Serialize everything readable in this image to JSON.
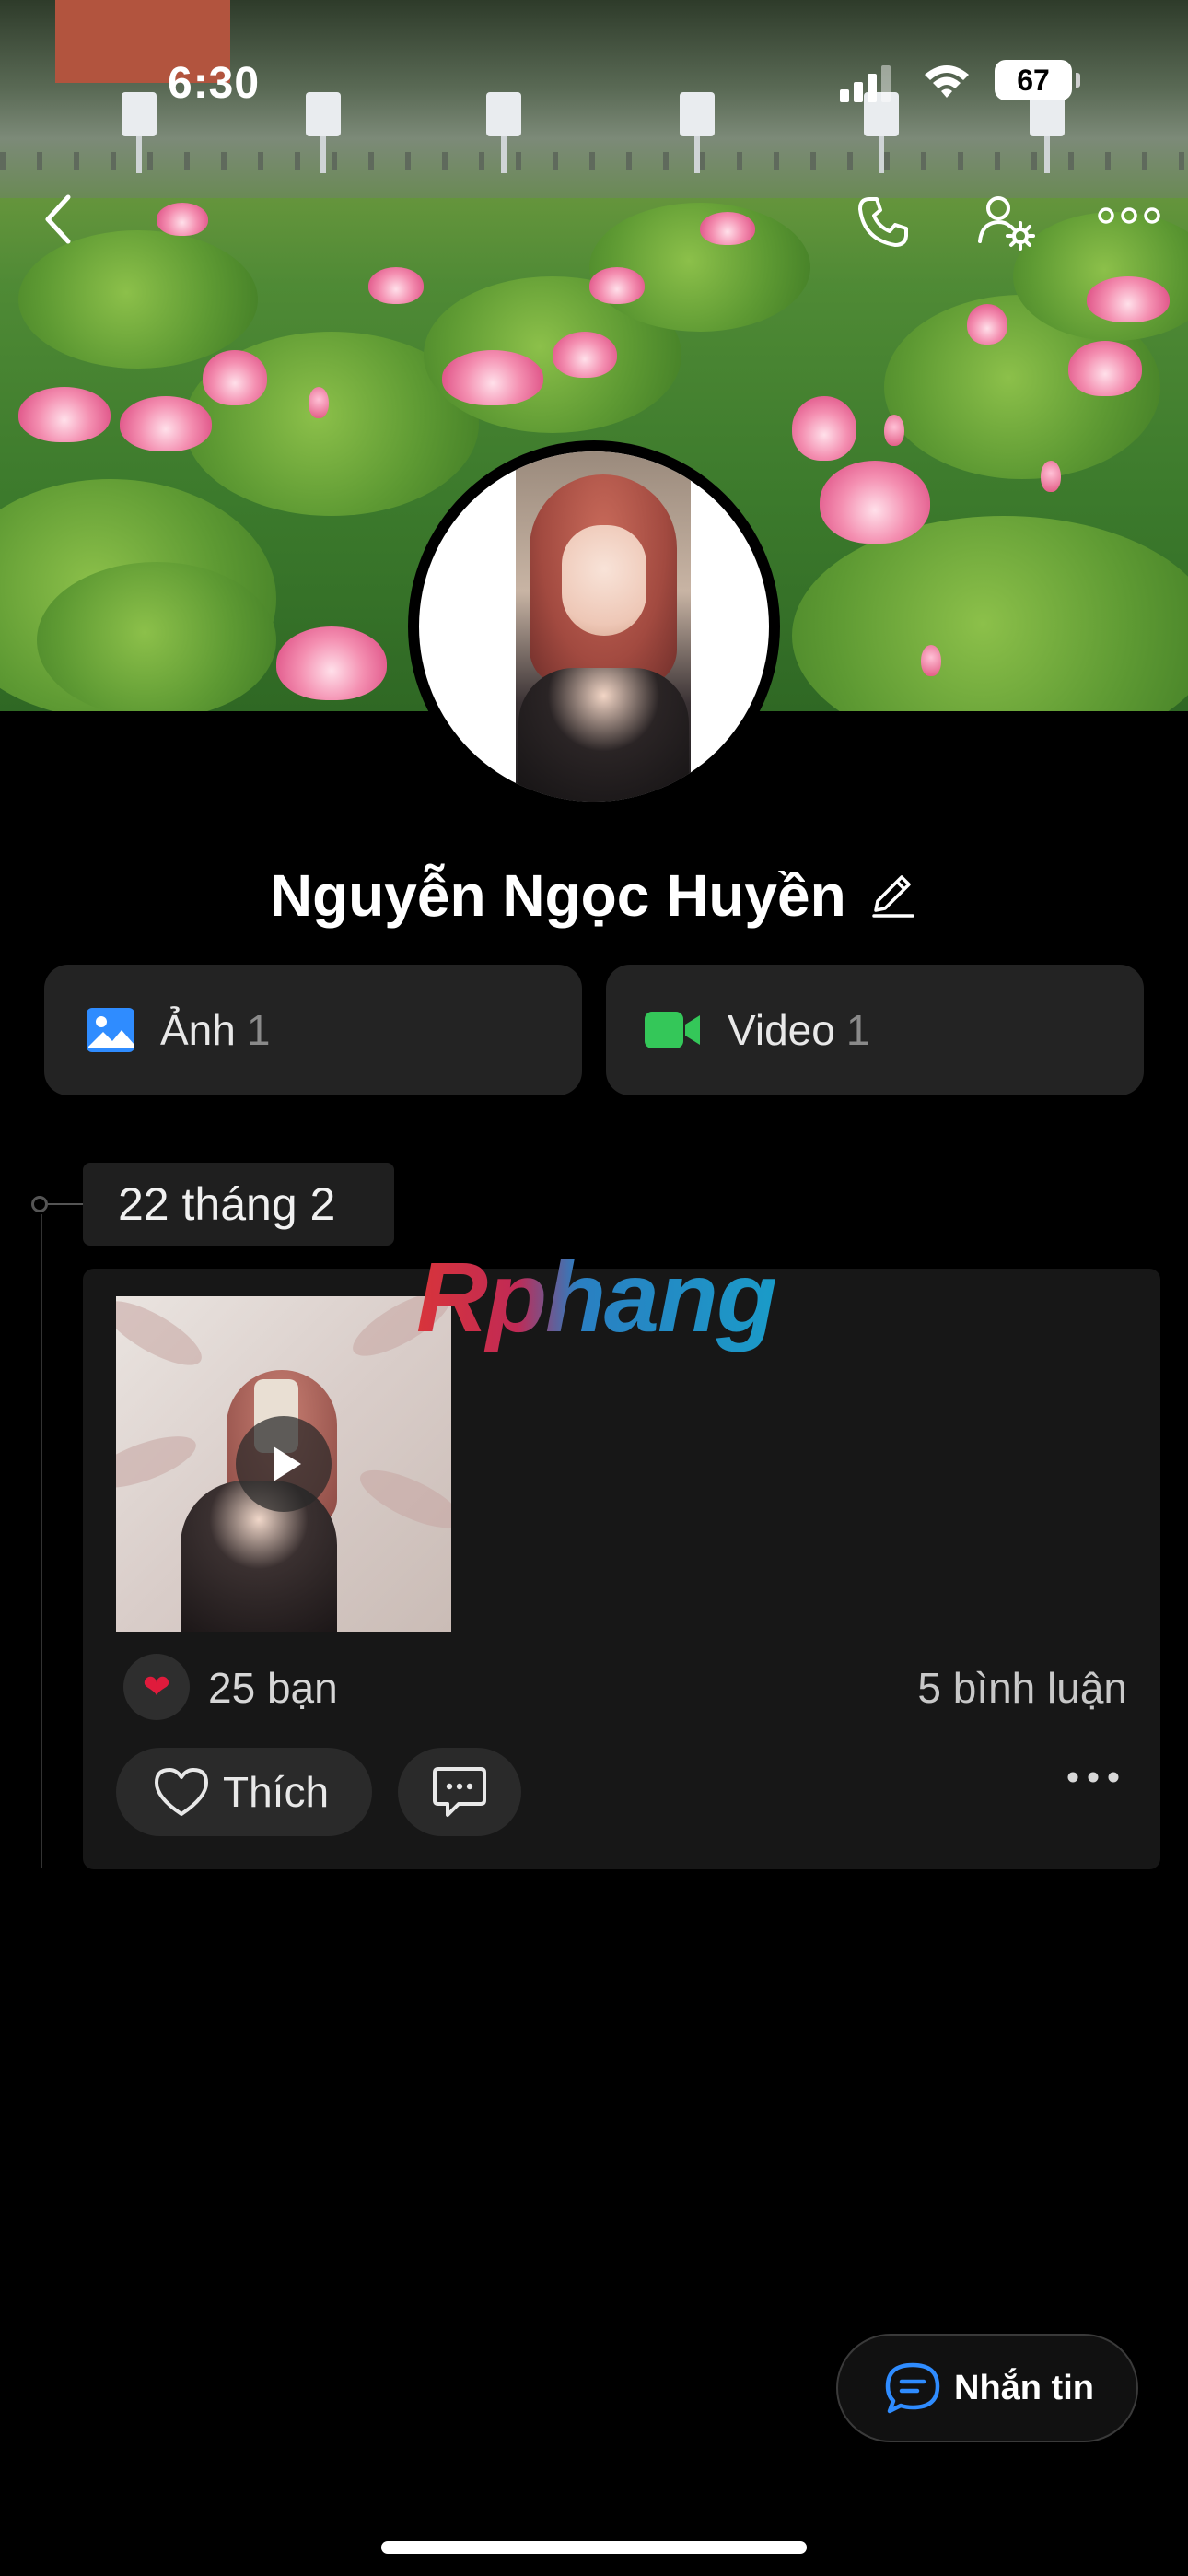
{
  "status_bar": {
    "time": "6:30",
    "battery": "67"
  },
  "profile": {
    "name": "Nguyễn Ngọc Huyền"
  },
  "media_buttons": [
    {
      "label": "Ảnh",
      "count": "1",
      "icon": "photo-icon",
      "color": "#2f8cff"
    },
    {
      "label": "Video",
      "count": "1",
      "icon": "video-camera-icon",
      "color": "#34c759"
    }
  ],
  "timeline": {
    "date": "22 tháng 2",
    "post": {
      "reaction_emoji": "❤",
      "reaction_count": "25 bạn",
      "comment_count": "5 bình luận",
      "like_label": "Thích"
    }
  },
  "watermark": "Rphang",
  "message_button": {
    "label": "Nhắn tin"
  },
  "colors": {
    "background": "#000000",
    "card": "#232323",
    "post": "#171717",
    "accent_blue": "#2f8cff",
    "accent_green": "#34c759",
    "heart": "#e01b3c"
  }
}
